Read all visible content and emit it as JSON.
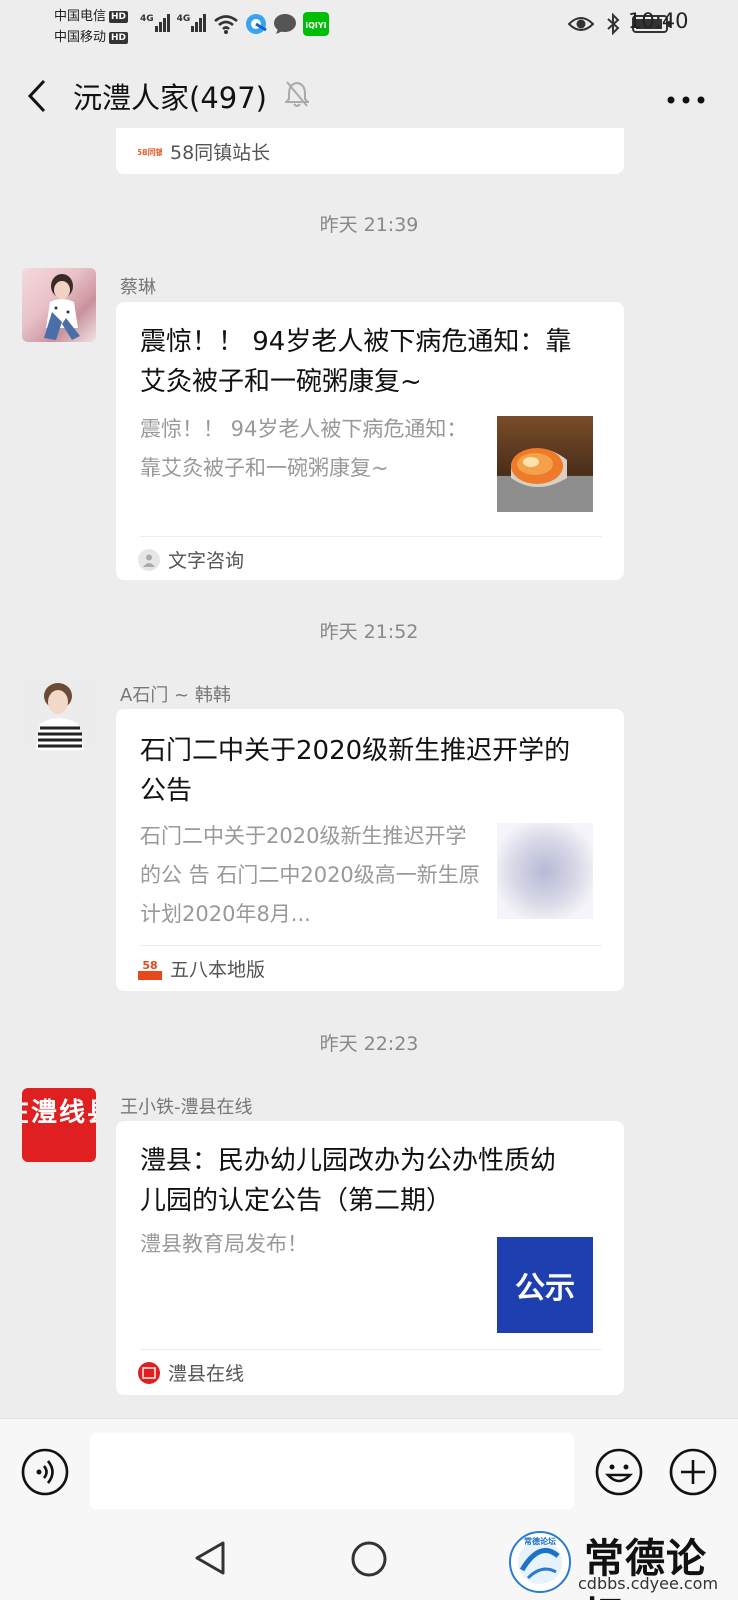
{
  "status_bar": {
    "carrier_1": "中国电信",
    "carrier_2": "中国移动",
    "hd": "HD",
    "net_1": "4G",
    "net_2": "4G",
    "app_icon": "iQIYI",
    "time": "10:40",
    "icons": [
      "signal-icon",
      "wifi-icon",
      "browser-icon",
      "message-icon",
      "iqiyi-icon",
      "eye-icon",
      "bluetooth-icon",
      "battery-icon"
    ]
  },
  "nav": {
    "title": "沅澧人家(497)",
    "icons": [
      "back-icon",
      "mute-bell-icon",
      "more-icon"
    ]
  },
  "partial_card": {
    "source": "58同镇站长",
    "source_icon_text": "58同镇"
  },
  "messages": [
    {
      "time": "昨天 21:39",
      "sender": "蔡琳",
      "title": "震惊！！ 94岁老人被下病危通知：靠艾灸被子和一碗粥康复~",
      "desc": "震惊！！ 94岁老人被下病危通知：靠艾灸被子和一碗粥康复~",
      "source": "文字咨询"
    },
    {
      "time": "昨天 21:52",
      "sender": "A石门 ~ 韩韩",
      "title": "石门二中关于2020级新生推迟开学的公告",
      "desc": "石门二中关于2020级新生推迟开学的公 告 石门二中2020级高一新生原计划2020年8月...",
      "source": "五八本地版",
      "source_icon_text": "58"
    },
    {
      "time": "昨天 22:23",
      "sender": "王小铁-澧县在线",
      "avatar_text": "在澧线县",
      "title": "澧县：民办幼儿园改办为公办性质幼儿园的认定公告（第二期）",
      "desc": "澧县教育局发布！",
      "thumb_text": "公示",
      "source": "澧县在线"
    }
  ],
  "input_bar": {
    "placeholder": "",
    "icons": [
      "voice-icon",
      "emoji-icon",
      "plus-icon"
    ]
  },
  "system_nav": {
    "icons": [
      "back-triangle-icon",
      "home-circle-icon"
    ]
  },
  "watermark": {
    "title": "常德论坛",
    "url": "cdbbs.cdyee.com",
    "logo_text": "常德论坛"
  },
  "colors": {
    "background": "#ededed",
    "card": "#ffffff",
    "avatar_red": "#e02020",
    "thumb_blue": "#1e3fb0",
    "wechat_green": "#07c160"
  }
}
